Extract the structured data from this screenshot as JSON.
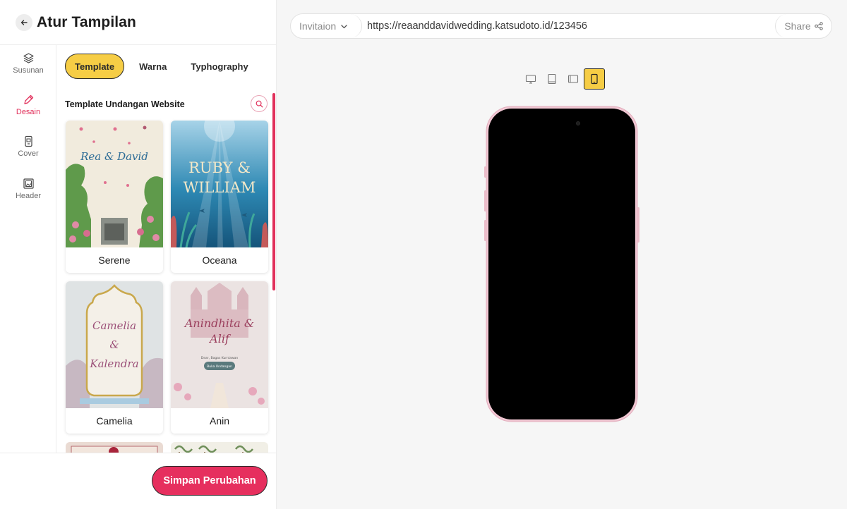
{
  "header": {
    "title": "Atur Tampilan"
  },
  "rail": [
    {
      "label": "Susunan",
      "icon": "layers-icon"
    },
    {
      "label": "Desain",
      "icon": "pencil-icon",
      "active": true
    },
    {
      "label": "Cover",
      "icon": "phone-cover-icon"
    },
    {
      "label": "Header",
      "icon": "image-frame-icon"
    }
  ],
  "tabs": [
    {
      "label": "Template",
      "active": true
    },
    {
      "label": "Warna"
    },
    {
      "label": "Typhography"
    }
  ],
  "section": {
    "title": "Template Undangan Website"
  },
  "templates": [
    {
      "name": "Serene",
      "thumb_text": "Rea & David"
    },
    {
      "name": "Oceana",
      "thumb_text_1": "RUBY &",
      "thumb_text_2": "WILLIAM"
    },
    {
      "name": "Camelia",
      "thumb_text_1": "Camelia",
      "thumb_text_2": "&",
      "thumb_text_3": "Kalendra"
    },
    {
      "name": "Anin",
      "thumb_text_1": "Anindhita &",
      "thumb_text_2": "Alif",
      "thumb_sub": "Dear, Bagas Kurniawan",
      "thumb_btn": "Buka Undangan"
    }
  ],
  "footer": {
    "save_label": "Simpan Perubahan"
  },
  "preview": {
    "select_value": "Invitaion",
    "url": "https://reaanddavidwedding.katsudoto.id/123456",
    "share_label": "Share",
    "devices": [
      "desktop-icon",
      "tablet-icon",
      "tablet-landscape-icon",
      "mobile-icon"
    ],
    "active_device": "mobile-icon"
  },
  "colors": {
    "accent": "#e62f5e",
    "highlight": "#f6cd45",
    "phone_frame": "#f1c7d3"
  }
}
